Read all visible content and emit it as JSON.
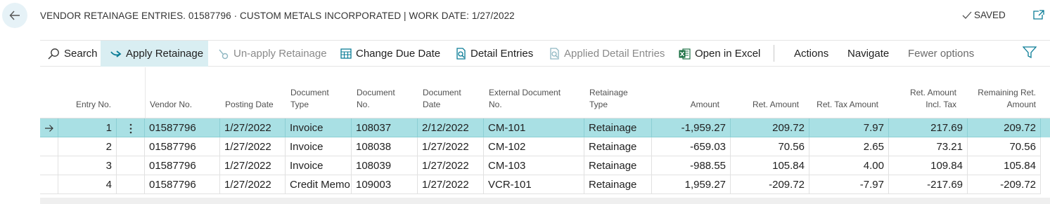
{
  "header": {
    "title": "VENDOR RETAINAGE ENTRIES. 01587796 · CUSTOM METALS INCORPORATED | WORK DATE: 1/27/2022",
    "saved_label": "SAVED"
  },
  "actions": {
    "search": "Search",
    "apply_retainage": "Apply Retainage",
    "unapply_retainage": "Un-apply Retainage",
    "change_due_date": "Change Due Date",
    "detail_entries": "Detail Entries",
    "applied_detail_entries": "Applied Detail Entries",
    "open_in_excel": "Open in Excel",
    "actions": "Actions",
    "navigate": "Navigate",
    "fewer_options": "Fewer options"
  },
  "columns": {
    "entry_no": "Entry No.",
    "vendor_no": "Vendor No.",
    "posting_date": "Posting Date",
    "document_type": [
      "Document",
      "Type"
    ],
    "document_no": [
      "Document",
      "No."
    ],
    "document_date": [
      "Document",
      "Date"
    ],
    "external_document_no": [
      "External Document",
      "No."
    ],
    "retainage_type": [
      "Retainage",
      "Type"
    ],
    "amount": "Amount",
    "ret_amount": "Ret. Amount",
    "ret_tax_amount": "Ret. Tax Amount",
    "ret_amount_incl_tax": [
      "Ret. Amount",
      "Incl. Tax"
    ],
    "remaining_ret_amount": [
      "Remaining Ret.",
      "Amount"
    ]
  },
  "rows": [
    {
      "entry_no": "1",
      "vendor_no": "01587796",
      "posting_date": "1/27/2022",
      "document_type": "Invoice",
      "document_no": "108037",
      "document_date": "2/12/2022",
      "external_document_no": "CM-101",
      "retainage_type": "Retainage",
      "amount": "-1,959.27",
      "ret_amount": "209.72",
      "ret_tax_amount": "7.97",
      "ret_amount_incl_tax": "217.69",
      "remaining_ret_amount": "209.72"
    },
    {
      "entry_no": "2",
      "vendor_no": "01587796",
      "posting_date": "1/27/2022",
      "document_type": "Invoice",
      "document_no": "108038",
      "document_date": "1/27/2022",
      "external_document_no": "CM-102",
      "retainage_type": "Retainage",
      "amount": "-659.03",
      "ret_amount": "70.56",
      "ret_tax_amount": "2.65",
      "ret_amount_incl_tax": "73.21",
      "remaining_ret_amount": "70.56"
    },
    {
      "entry_no": "3",
      "vendor_no": "01587796",
      "posting_date": "1/27/2022",
      "document_type": "Invoice",
      "document_no": "108039",
      "document_date": "1/27/2022",
      "external_document_no": "CM-103",
      "retainage_type": "Retainage",
      "amount": "-988.55",
      "ret_amount": "105.84",
      "ret_tax_amount": "4.00",
      "ret_amount_incl_tax": "109.84",
      "remaining_ret_amount": "105.84"
    },
    {
      "entry_no": "4",
      "vendor_no": "01587796",
      "posting_date": "1/27/2022",
      "document_type": "Credit Memo",
      "document_no": "109003",
      "document_date": "1/27/2022",
      "external_document_no": "VCR-101",
      "retainage_type": "Retainage",
      "amount": "1,959.27",
      "ret_amount": "-209.72",
      "ret_tax_amount": "-7.97",
      "ret_amount_incl_tax": "-217.69",
      "remaining_ret_amount": "-209.72"
    }
  ],
  "colors": {
    "accent": "#0a7c96",
    "selected_row": "#a9e0e4",
    "active_action": "#d9eef2",
    "excel_green": "#1e7145"
  },
  "icons": [
    "back-arrow-icon",
    "checkmark-icon",
    "popout-icon",
    "search-icon",
    "apply-arrow-icon",
    "unapply-icon",
    "calendar-grid-icon",
    "detail-entries-icon",
    "applied-detail-entries-icon",
    "excel-icon",
    "filter-icon",
    "row-arrow-icon",
    "row-menu-icon"
  ]
}
